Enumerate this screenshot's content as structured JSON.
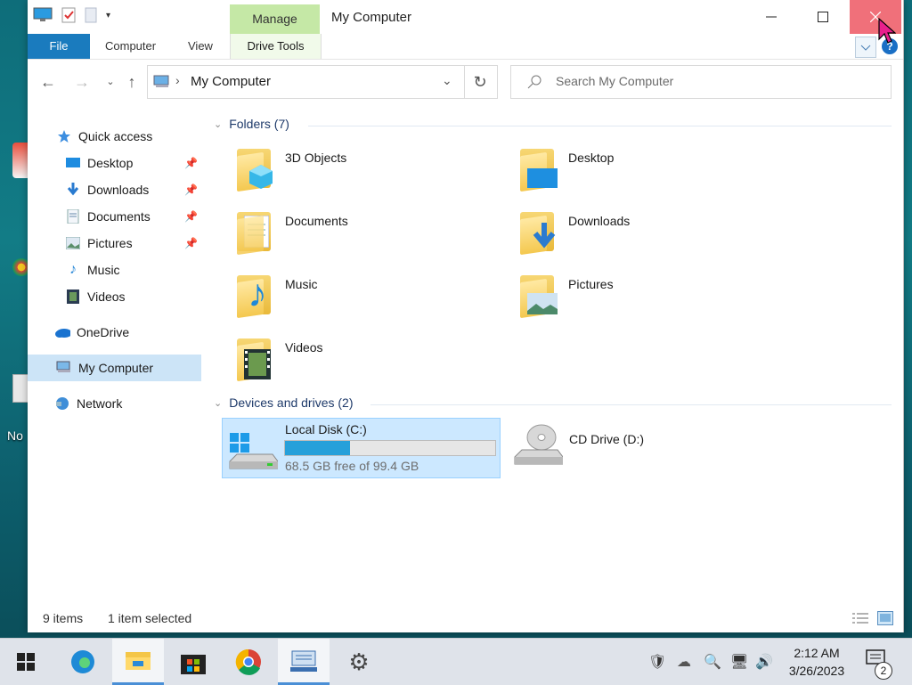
{
  "window": {
    "title": "My Computer",
    "manage_tab": "Manage",
    "drive_tools_tab": "Drive Tools",
    "ribbon_tabs": [
      "File",
      "Computer",
      "View"
    ],
    "help_label": "?"
  },
  "address": {
    "path": "My Computer"
  },
  "search": {
    "placeholder": "Search My Computer"
  },
  "sidebar": {
    "items": [
      {
        "label": "Quick access",
        "icon": "star-icon"
      },
      {
        "label": "Desktop",
        "icon": "desktop-icon",
        "pinned": true
      },
      {
        "label": "Downloads",
        "icon": "downloads-icon",
        "pinned": true
      },
      {
        "label": "Documents",
        "icon": "documents-icon",
        "pinned": true
      },
      {
        "label": "Pictures",
        "icon": "pictures-icon",
        "pinned": true
      },
      {
        "label": "Music",
        "icon": "music-icon"
      },
      {
        "label": "Videos",
        "icon": "videos-icon"
      },
      {
        "label": "OneDrive",
        "icon": "onedrive-icon"
      },
      {
        "label": "My Computer",
        "icon": "computer-icon",
        "selected": true
      },
      {
        "label": "Network",
        "icon": "network-icon"
      }
    ]
  },
  "content": {
    "folders_header": "Folders (7)",
    "folders": [
      "3D Objects",
      "Desktop",
      "Documents",
      "Downloads",
      "Music",
      "Pictures",
      "Videos"
    ],
    "devices_header": "Devices and drives (2)",
    "drives": [
      {
        "name": "Local Disk (C:)",
        "free_text": "68.5 GB free of 99.4 GB",
        "used_fraction": 0.31,
        "selected": true
      },
      {
        "name": "CD Drive (D:)"
      }
    ]
  },
  "status": {
    "items": "9 items",
    "selected": "1 item selected"
  },
  "desktop": {
    "label_1": "No"
  },
  "taskbar": {
    "time": "2:12 AM",
    "date": "3/26/2023",
    "notification_count": "2"
  },
  "colors": {
    "accent": "#1a7bbe",
    "selection": "#cce8ff",
    "close_hover": "#f0707a",
    "manage_tab": "#c5e8a6"
  }
}
